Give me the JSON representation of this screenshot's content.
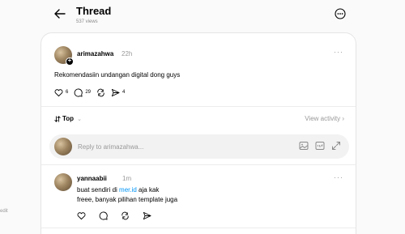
{
  "edge": {
    "text": "edit"
  },
  "header": {
    "title": "Thread",
    "views": "537 views"
  },
  "post": {
    "username": "arimazahwa",
    "time": "22h",
    "more": "···",
    "text": "Rekomendasiin undangan digital dong guys",
    "likes": "6",
    "comments": "29",
    "shares": "4"
  },
  "sort": {
    "label": "Top",
    "view_activity": "View activity"
  },
  "reply": {
    "placeholder": "Reply to arimazahwa..."
  },
  "comment": {
    "username": "yannaabii",
    "time": "1m",
    "more": "···",
    "text_before": "buat sendiri di ",
    "link": "mer.id",
    "text_after": " aja kak",
    "line2": "freee, banyak pilihan template juga"
  }
}
